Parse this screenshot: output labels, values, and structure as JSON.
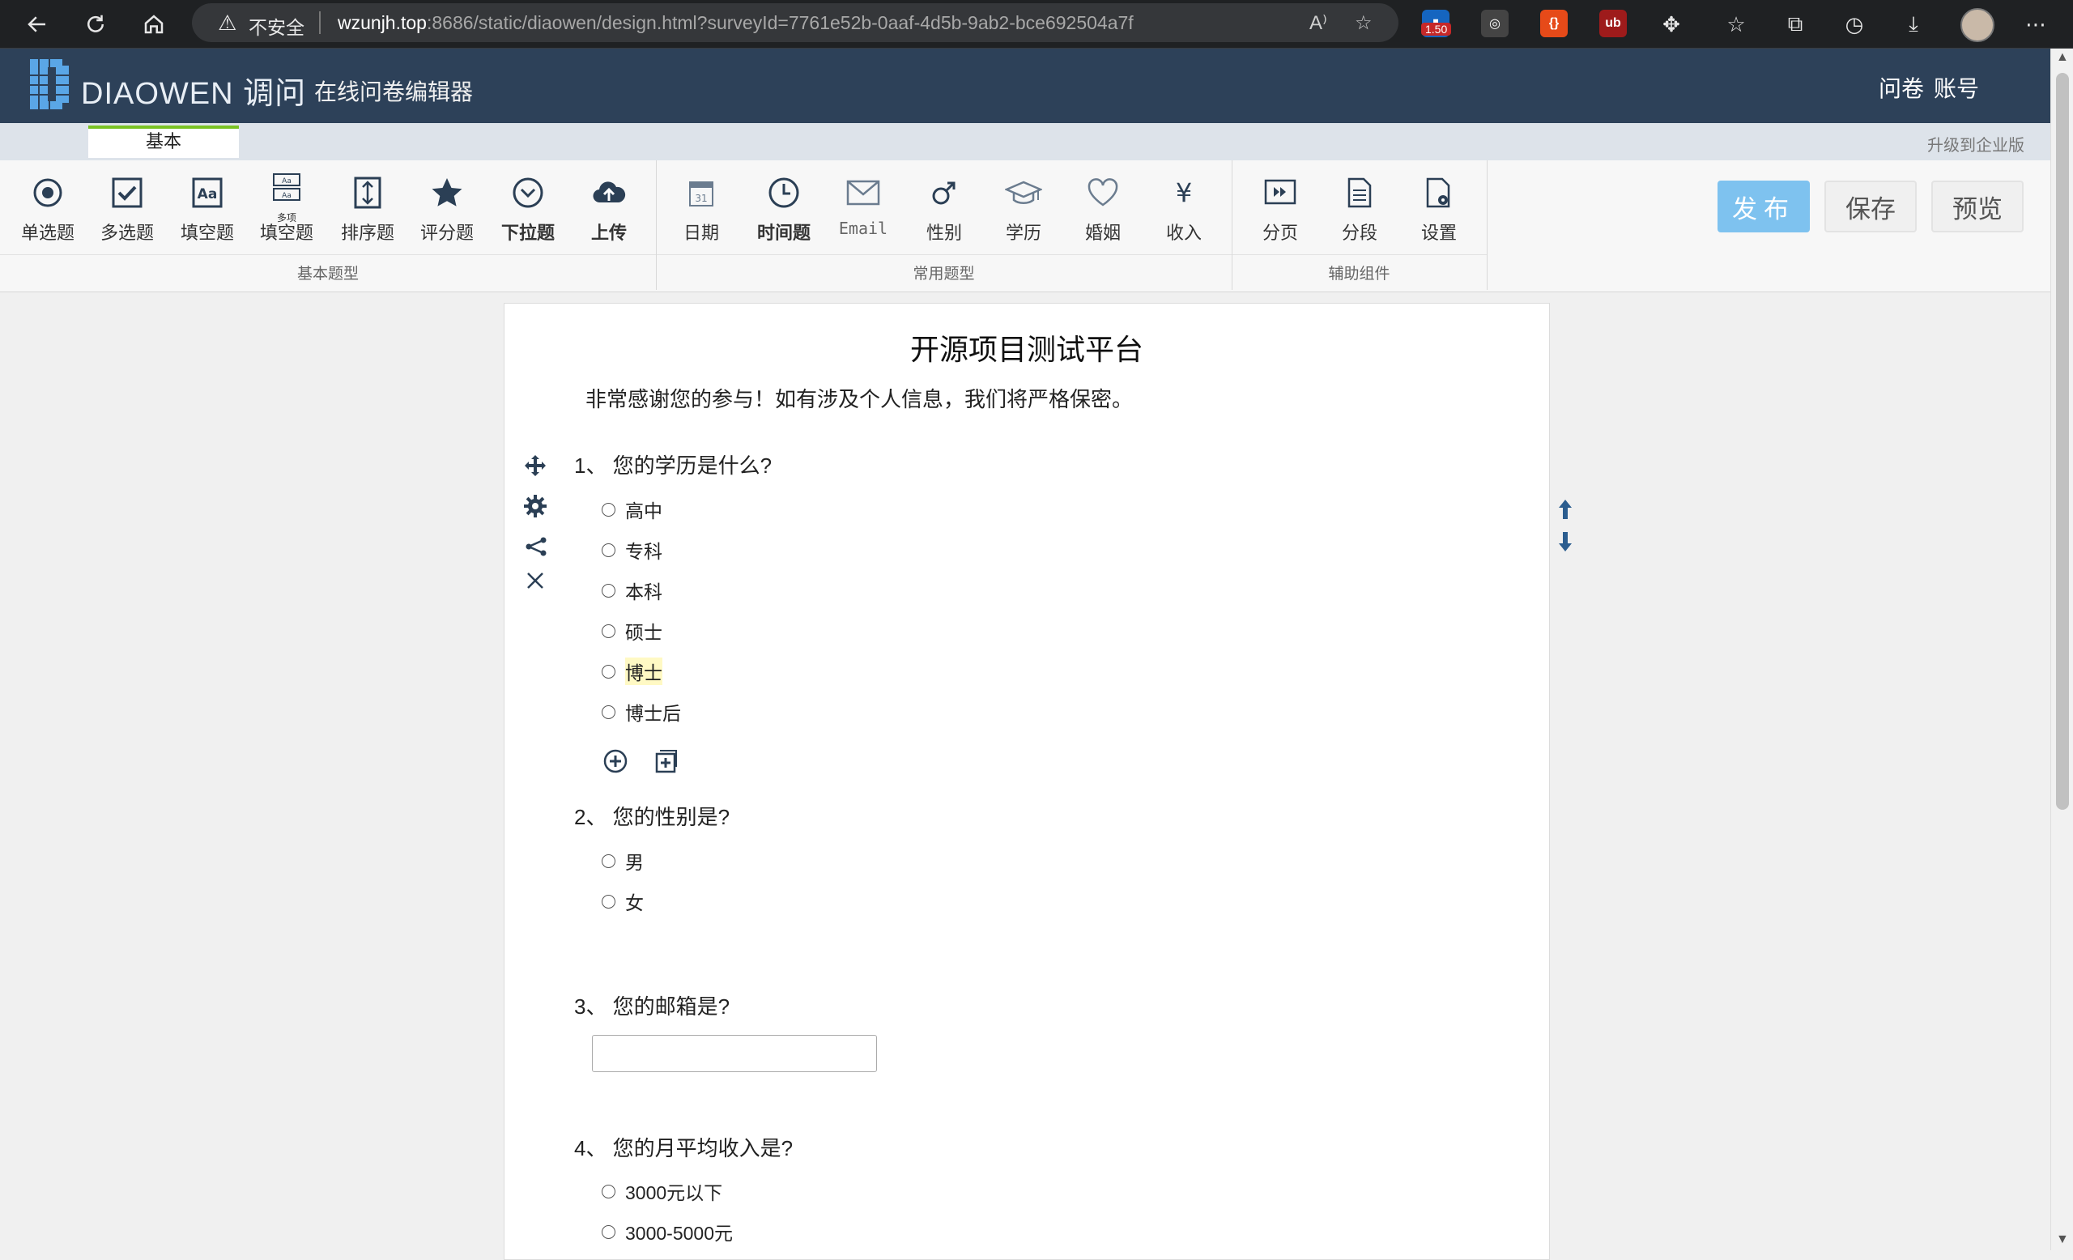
{
  "browser": {
    "insecure_label": "不安全",
    "url_host": "wzunjh.top",
    "url_path": ":8686/static/diaowen/design.html?surveyId=7761e52b-0aaf-4d5b-9ab2-bce692504a7f",
    "ext_badge": "1.50"
  },
  "app": {
    "brand": "DIAOWEN 调问",
    "subtitle": "在线问卷编辑器",
    "nav": [
      "问卷",
      "账号"
    ],
    "tab": "基本",
    "upgrade": "升级到企业版"
  },
  "toolbar": {
    "basic_items": [
      "单选题",
      "多选题",
      "填空题",
      "填空题",
      "排序题",
      "评分题",
      "下拉题",
      "上传"
    ],
    "multi_fill_tag": "多项",
    "common_items": [
      "日期",
      "时间题",
      "Email",
      "性别",
      "学历",
      "婚姻",
      "收入"
    ],
    "aux_items": [
      "分页",
      "分段",
      "设置"
    ],
    "groups": [
      "基本题型",
      "常用题型",
      "辅助组件"
    ],
    "actions": {
      "publish": "发布",
      "save": "保存",
      "preview": "预览"
    }
  },
  "survey": {
    "title": "开源项目测试平台",
    "description": "非常感谢您的参与！如有涉及个人信息，我们将严格保密。",
    "questions": [
      {
        "title": "1、 您的学历是什么?",
        "options": [
          "高中",
          "专科",
          "本科",
          "硕士",
          "博士",
          "博士后"
        ]
      },
      {
        "title": "2、 您的性别是?",
        "options": [
          "男",
          "女"
        ]
      },
      {
        "title": "3、 您的邮箱是?"
      },
      {
        "title": "4、 您的月平均收入是?",
        "options": [
          "3000元以下",
          "3000-5000元"
        ]
      }
    ]
  }
}
